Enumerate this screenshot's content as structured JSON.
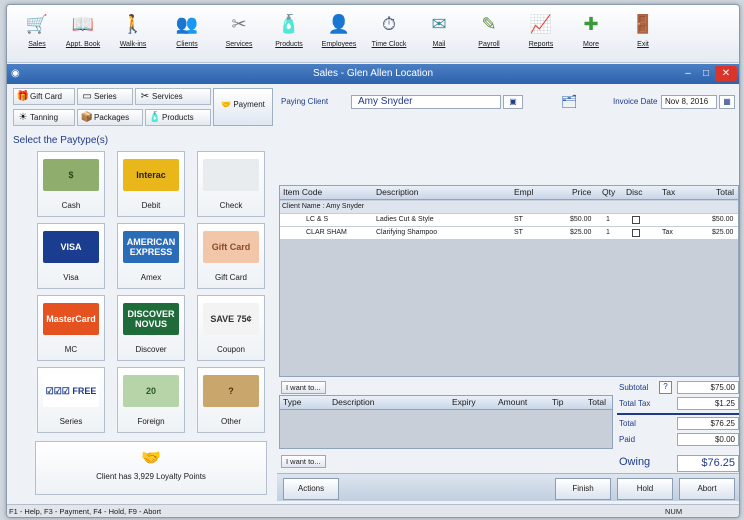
{
  "toolbar": [
    {
      "label": "Sales",
      "icon": "sales-icon",
      "glyph": "🛒",
      "color": "#3b8a3a"
    },
    {
      "label": "Appt. Book",
      "icon": "appt-book-icon",
      "glyph": "📖",
      "color": "#6b7a8c"
    },
    {
      "label": "Walk-ins",
      "icon": "walk-ins-icon",
      "glyph": "🚶",
      "color": "#2c6fb5"
    },
    {
      "label": "Clients",
      "icon": "clients-icon",
      "glyph": "👥",
      "color": "#b36b2e"
    },
    {
      "label": "Services",
      "icon": "services-icon",
      "glyph": "✂",
      "color": "#7a7a7a"
    },
    {
      "label": "Products",
      "icon": "products-icon",
      "glyph": "🧴",
      "color": "#c94a2f"
    },
    {
      "label": "Employees",
      "icon": "employees-icon",
      "glyph": "👤",
      "color": "#8a3fa0"
    },
    {
      "label": "Time Clock",
      "icon": "time-clock-icon",
      "glyph": "⏱",
      "color": "#4a5a7a"
    },
    {
      "label": "Mail",
      "icon": "mail-icon",
      "glyph": "✉",
      "color": "#3f8a9e"
    },
    {
      "label": "Payroll",
      "icon": "payroll-icon",
      "glyph": "✎",
      "color": "#5a8a3a"
    },
    {
      "label": "Reports",
      "icon": "reports-icon",
      "glyph": "📈",
      "color": "#2f6aa8"
    },
    {
      "label": "More",
      "icon": "more-icon",
      "glyph": "✚",
      "color": "#3a9a3a"
    },
    {
      "label": "Exit",
      "icon": "exit-icon",
      "glyph": "🚪",
      "color": "#c0392b"
    }
  ],
  "window": {
    "title": "Sales - Glen Allen Location",
    "min": "–",
    "max": "□",
    "close": "✕"
  },
  "tabs": [
    {
      "label": "Gift Card",
      "glyph": "🎁"
    },
    {
      "label": "Series",
      "glyph": "▭"
    },
    {
      "label": "Services",
      "glyph": "✂"
    },
    {
      "label": "Tanning",
      "glyph": "☀"
    },
    {
      "label": "Packages",
      "glyph": "📦"
    },
    {
      "label": "Products",
      "glyph": "🧴"
    }
  ],
  "payment_button": "Payment",
  "select_title": "Select the Paytype(s)",
  "paytypes": [
    {
      "label": "Cash",
      "img_text": "$",
      "bg": "#8fae6e",
      "fg": "#234a16"
    },
    {
      "label": "Debit",
      "img_text": "Interac",
      "bg": "#e9b719",
      "fg": "#222"
    },
    {
      "label": "Check",
      "img_text": "",
      "bg": "#e8ecef",
      "fg": "#555"
    },
    {
      "label": "Visa",
      "img_text": "VISA",
      "bg": "#1a3d8f",
      "fg": "#ffffff"
    },
    {
      "label": "Amex",
      "img_text": "AMERICAN EXPRESS",
      "bg": "#2b6cb8",
      "fg": "#ffffff"
    },
    {
      "label": "Gift Card",
      "img_text": "Gift Card",
      "bg": "#f2c6a8",
      "fg": "#8a4a2a"
    },
    {
      "label": "MC",
      "img_text": "MasterCard",
      "bg": "#e6521f",
      "fg": "#ffffff"
    },
    {
      "label": "Discover",
      "img_text": "DISCOVER NOVUS",
      "bg": "#1f6b3a",
      "fg": "#ffffff"
    },
    {
      "label": "Coupon",
      "img_text": "SAVE 75¢",
      "bg": "#f3f3f3",
      "fg": "#333"
    },
    {
      "label": "Series",
      "img_text": "☑☑☑ FREE",
      "bg": "#ffffff",
      "fg": "#1f3a8a"
    },
    {
      "label": "Foreign",
      "img_text": "20",
      "bg": "#b7d3a8",
      "fg": "#2a5a2a"
    },
    {
      "label": "Other",
      "img_text": "?",
      "bg": "#c9a66b",
      "fg": "#4a3000"
    }
  ],
  "loyalty": "Client has 3,929 Loyalty Points",
  "paying_client": {
    "label": "Paying Client",
    "value": "Amy Snyder"
  },
  "invoice": {
    "label": "Invoice Date",
    "value": "Nov 8, 2016"
  },
  "item_grid": {
    "headers": [
      "Item Code",
      "Description",
      "Empl",
      "Price",
      "Qty",
      "Disc",
      "Tax",
      "Total"
    ],
    "client_row": "Client Name : Amy Snyder",
    "rows": [
      {
        "code": "LC & S",
        "desc": "Ladies Cut & Style",
        "empl": "ST",
        "price": "$50.00",
        "qty": "1",
        "tax": "",
        "total": "$50.00"
      },
      {
        "code": "CLAR SHAM",
        "desc": "Clarifying Shampoo",
        "empl": "ST",
        "price": "$25.00",
        "qty": "1",
        "tax": "Tax",
        "total": "$25.00"
      }
    ]
  },
  "want_to": "I want to...",
  "payment_grid": {
    "headers": [
      "Type",
      "Description",
      "Expiry",
      "Amount",
      "Tip",
      "Total"
    ]
  },
  "totals": {
    "subtotal_label": "Subtotal",
    "help": "?",
    "subtotal": "$75.00",
    "tax_label": "Total Tax",
    "tax": "$1.25",
    "total_label": "Total",
    "total": "$76.25",
    "paid_label": "Paid",
    "paid": "$0.00",
    "owing_label": "Owing",
    "owing": "$76.25"
  },
  "actions": {
    "actions": "Actions",
    "finish": "Finish",
    "hold": "Hold",
    "abort": "Abort"
  },
  "status": {
    "text": "F1 - Help, F3 - Payment, F4 - Hold, F9 - Abort",
    "num": "NUM"
  }
}
